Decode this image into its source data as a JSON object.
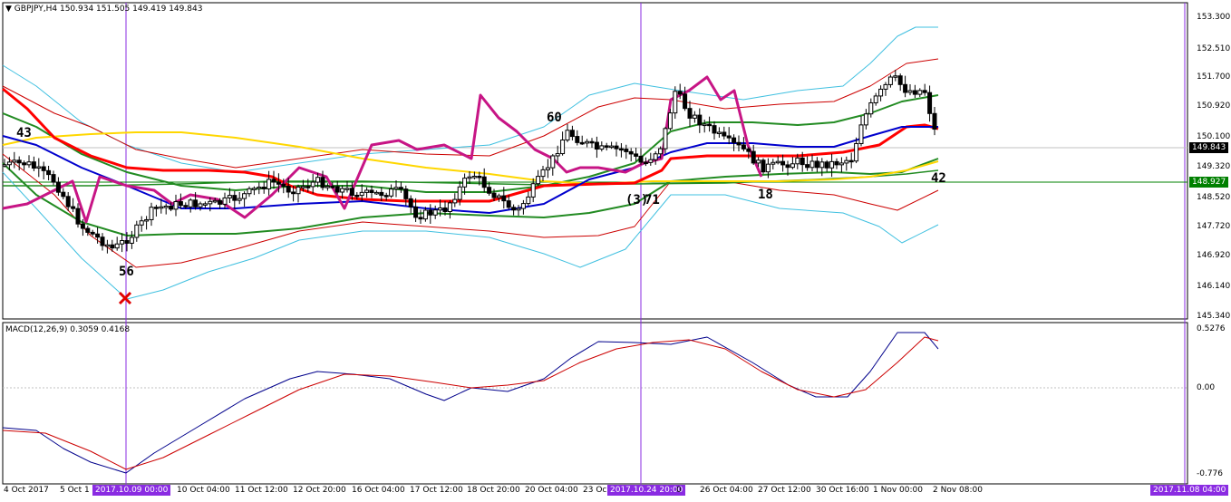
{
  "main_panel": {
    "header": "GBPJPY,H4  150.934 151.505 149.419 149.843",
    "price_axis": [
      "153.300",
      "152.510",
      "151.700",
      "150.920",
      "150.100",
      "149.320",
      "148.520",
      "147.720",
      "146.920",
      "146.140",
      "145.340"
    ],
    "current_price": "149.843",
    "hline_price": "148.927",
    "wave_labels": {
      "a": "43",
      "b": "56",
      "c": "60",
      "d": "(3)",
      "e": "71",
      "f": "18",
      "g": "42"
    },
    "cross_icon": "red-x-marker"
  },
  "macd_panel": {
    "header": "MACD(12,26,9) 0.3059 0.4168",
    "axis": [
      "0.5276",
      "0.00",
      "-0.776"
    ]
  },
  "time_axis": [
    "4 Oct 2017",
    "5 Oct 1",
    "10 Oct 04:00",
    "11 Oct 12:00",
    "12 Oct 20:00",
    "16 Oct 04:00",
    "17 Oct 12:00",
    "18 Oct 20:00",
    "20 Oct 04:00",
    "23 Oc",
    "26 Oct 04:00",
    "27 Oct 12:00",
    "30 Oct 16:00",
    "1 Nov 00:00",
    "2 Nov 08:00"
  ],
  "vline_labels": {
    "first": "2017.10.09 00:00",
    "second": "2017.10.24 20:00",
    "second_suffix": "0",
    "third": "2017.11.08 04:00"
  },
  "colors": {
    "bg": "#ffffff",
    "candle": "#000000",
    "vline": "#8a2be2",
    "ma_red": "#ff0000",
    "ma_blue": "#0000cd",
    "ma_green": "#228b22",
    "ma_gold": "#ffd700",
    "bb_cyan": "#40c0e0",
    "bb_red": "#cc0000",
    "magenta": "#c71585",
    "macd_main": "#00008b",
    "macd_signal": "#cc0000",
    "hline_green": "#008000"
  }
}
